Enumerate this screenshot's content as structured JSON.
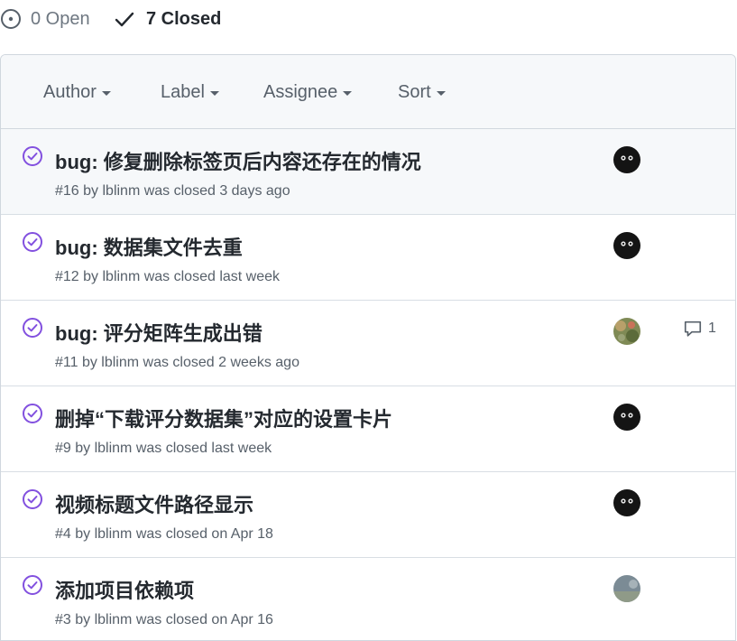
{
  "states": {
    "open_label": "0 Open",
    "closed_label": "7 Closed"
  },
  "filters": {
    "author": "Author",
    "label": "Label",
    "assignee": "Assignee",
    "sort": "Sort"
  },
  "colors": {
    "closed_icon": "#8250df",
    "text_primary": "#24292f",
    "text_muted": "#57606a",
    "header_bg": "#f6f8fa",
    "border": "#d0d7de"
  },
  "issues": [
    {
      "title": "bug: 修复删除标签页后内容还存在的情况",
      "meta": "#16 by lblinm was closed 3 days ago",
      "avatar": "dark-avatar",
      "comments": ""
    },
    {
      "title": "bug: 数据集文件去重",
      "meta": "#12 by lblinm was closed last week",
      "avatar": "dark-avatar",
      "comments": ""
    },
    {
      "title": "bug: 评分矩阵生成出错",
      "meta": "#11 by lblinm was closed 2 weeks ago",
      "avatar": "camo-avatar",
      "comments": "1"
    },
    {
      "title": "删掉“下载评分数据集”对应的设置卡片",
      "meta": "#9 by lblinm was closed last week",
      "avatar": "dark-avatar",
      "comments": ""
    },
    {
      "title": "视频标题文件路径显示",
      "meta": "#4 by lblinm was closed on Apr 18",
      "avatar": "dark-avatar",
      "comments": ""
    },
    {
      "title": "添加项目依赖项",
      "meta": "#3 by lblinm was closed on Apr 16",
      "avatar": "landscape-avatar",
      "comments": ""
    }
  ]
}
